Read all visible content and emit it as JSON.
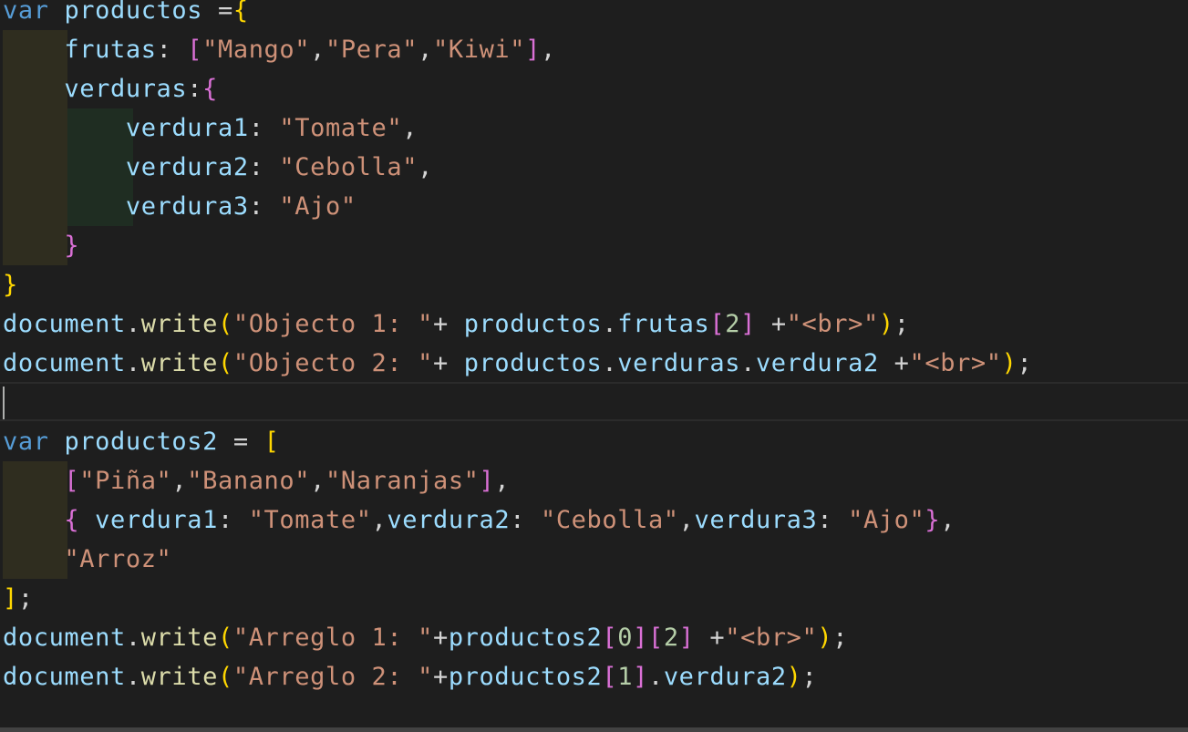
{
  "editor": {
    "language": "javascript",
    "lines": [
      {
        "indent": 0,
        "tokens": [
          {
            "t": "var",
            "c": "kw"
          },
          {
            "t": " "
          },
          {
            "t": "productos",
            "c": "var"
          },
          {
            "t": " =",
            "c": "op"
          },
          {
            "t": "{",
            "c": "b1"
          }
        ]
      },
      {
        "indent": 1,
        "tokens": [
          {
            "t": "    "
          },
          {
            "t": "frutas",
            "c": "var"
          },
          {
            "t": ": ",
            "c": "op"
          },
          {
            "t": "[",
            "c": "b2"
          },
          {
            "t": "\"Mango\"",
            "c": "str"
          },
          {
            "t": ",",
            "c": "op"
          },
          {
            "t": "\"Pera\"",
            "c": "str"
          },
          {
            "t": ",",
            "c": "op"
          },
          {
            "t": "\"Kiwi\"",
            "c": "str"
          },
          {
            "t": "]",
            "c": "b2"
          },
          {
            "t": ",",
            "c": "op"
          }
        ]
      },
      {
        "indent": 1,
        "tokens": [
          {
            "t": "    "
          },
          {
            "t": "verduras",
            "c": "var"
          },
          {
            "t": ":",
            "c": "op"
          },
          {
            "t": "{",
            "c": "b2"
          }
        ]
      },
      {
        "indent": 2,
        "tokens": [
          {
            "t": "        "
          },
          {
            "t": "verdura1",
            "c": "var"
          },
          {
            "t": ": ",
            "c": "op"
          },
          {
            "t": "\"Tomate\"",
            "c": "str"
          },
          {
            "t": ",",
            "c": "op"
          }
        ]
      },
      {
        "indent": 2,
        "tokens": [
          {
            "t": "        "
          },
          {
            "t": "verdura2",
            "c": "var"
          },
          {
            "t": ": ",
            "c": "op"
          },
          {
            "t": "\"Cebolla\"",
            "c": "str"
          },
          {
            "t": ",",
            "c": "op"
          }
        ]
      },
      {
        "indent": 2,
        "tokens": [
          {
            "t": "        "
          },
          {
            "t": "verdura3",
            "c": "var"
          },
          {
            "t": ": ",
            "c": "op"
          },
          {
            "t": "\"Ajo\"",
            "c": "str"
          }
        ]
      },
      {
        "indent": 1,
        "tokens": [
          {
            "t": "    "
          },
          {
            "t": "}",
            "c": "b2"
          }
        ]
      },
      {
        "indent": 0,
        "tokens": [
          {
            "t": "}",
            "c": "b1"
          }
        ]
      },
      {
        "indent": 0,
        "tokens": [
          {
            "t": "document",
            "c": "var"
          },
          {
            "t": ".",
            "c": "op"
          },
          {
            "t": "write",
            "c": "fn"
          },
          {
            "t": "(",
            "c": "b1"
          },
          {
            "t": "\"Objecto 1: \"",
            "c": "str"
          },
          {
            "t": "+ ",
            "c": "op"
          },
          {
            "t": "productos",
            "c": "var"
          },
          {
            "t": ".",
            "c": "op"
          },
          {
            "t": "frutas",
            "c": "var"
          },
          {
            "t": "[",
            "c": "b2"
          },
          {
            "t": "2",
            "c": "num"
          },
          {
            "t": "]",
            "c": "b2"
          },
          {
            "t": " +",
            "c": "op"
          },
          {
            "t": "\"<br>\"",
            "c": "str"
          },
          {
            "t": ")",
            "c": "b1"
          },
          {
            "t": ";",
            "c": "op"
          }
        ]
      },
      {
        "indent": 0,
        "tokens": [
          {
            "t": "document",
            "c": "var"
          },
          {
            "t": ".",
            "c": "op"
          },
          {
            "t": "write",
            "c": "fn"
          },
          {
            "t": "(",
            "c": "b1"
          },
          {
            "t": "\"Objecto 2: \"",
            "c": "str"
          },
          {
            "t": "+ ",
            "c": "op"
          },
          {
            "t": "productos",
            "c": "var"
          },
          {
            "t": ".",
            "c": "op"
          },
          {
            "t": "verduras",
            "c": "var"
          },
          {
            "t": ".",
            "c": "op"
          },
          {
            "t": "verdura2",
            "c": "var"
          },
          {
            "t": " +",
            "c": "op"
          },
          {
            "t": "\"<br>\"",
            "c": "str"
          },
          {
            "t": ")",
            "c": "b1"
          },
          {
            "t": ";",
            "c": "op"
          }
        ]
      },
      {
        "indent": 0,
        "tokens": []
      },
      {
        "indent": 0,
        "tokens": [
          {
            "t": "var",
            "c": "kw"
          },
          {
            "t": " "
          },
          {
            "t": "productos2",
            "c": "var"
          },
          {
            "t": " = ",
            "c": "op"
          },
          {
            "t": "[",
            "c": "b1"
          }
        ]
      },
      {
        "indent": 1,
        "tokens": [
          {
            "t": "    "
          },
          {
            "t": "[",
            "c": "b2"
          },
          {
            "t": "\"Piña\"",
            "c": "str"
          },
          {
            "t": ",",
            "c": "op"
          },
          {
            "t": "\"Banano\"",
            "c": "str"
          },
          {
            "t": ",",
            "c": "op"
          },
          {
            "t": "\"Naranjas\"",
            "c": "str"
          },
          {
            "t": "]",
            "c": "b2"
          },
          {
            "t": ",",
            "c": "op"
          }
        ]
      },
      {
        "indent": 1,
        "tokens": [
          {
            "t": "    "
          },
          {
            "t": "{",
            "c": "b2"
          },
          {
            "t": " "
          },
          {
            "t": "verdura1",
            "c": "var"
          },
          {
            "t": ": ",
            "c": "op"
          },
          {
            "t": "\"Tomate\"",
            "c": "str"
          },
          {
            "t": ",",
            "c": "op"
          },
          {
            "t": "verdura2",
            "c": "var"
          },
          {
            "t": ": ",
            "c": "op"
          },
          {
            "t": "\"Cebolla\"",
            "c": "str"
          },
          {
            "t": ",",
            "c": "op"
          },
          {
            "t": "verdura3",
            "c": "var"
          },
          {
            "t": ": ",
            "c": "op"
          },
          {
            "t": "\"Ajo\"",
            "c": "str"
          },
          {
            "t": "}",
            "c": "b2"
          },
          {
            "t": ",",
            "c": "op"
          }
        ]
      },
      {
        "indent": 1,
        "tokens": [
          {
            "t": "    "
          },
          {
            "t": "\"Arroz\"",
            "c": "str"
          }
        ]
      },
      {
        "indent": 0,
        "tokens": [
          {
            "t": "]",
            "c": "b1"
          },
          {
            "t": ";",
            "c": "op"
          }
        ]
      },
      {
        "indent": 0,
        "tokens": [
          {
            "t": "document",
            "c": "var"
          },
          {
            "t": ".",
            "c": "op"
          },
          {
            "t": "write",
            "c": "fn"
          },
          {
            "t": "(",
            "c": "b1"
          },
          {
            "t": "\"Arreglo 1: \"",
            "c": "str"
          },
          {
            "t": "+",
            "c": "op"
          },
          {
            "t": "productos2",
            "c": "var"
          },
          {
            "t": "[",
            "c": "b2"
          },
          {
            "t": "0",
            "c": "num"
          },
          {
            "t": "]",
            "c": "b2"
          },
          {
            "t": "[",
            "c": "b2"
          },
          {
            "t": "2",
            "c": "num"
          },
          {
            "t": "]",
            "c": "b2"
          },
          {
            "t": " +",
            "c": "op"
          },
          {
            "t": "\"<br>\"",
            "c": "str"
          },
          {
            "t": ")",
            "c": "b1"
          },
          {
            "t": ";",
            "c": "op"
          }
        ]
      },
      {
        "indent": 0,
        "tokens": [
          {
            "t": "document",
            "c": "var"
          },
          {
            "t": ".",
            "c": "op"
          },
          {
            "t": "write",
            "c": "fn"
          },
          {
            "t": "(",
            "c": "b1"
          },
          {
            "t": "\"Arreglo 2: \"",
            "c": "str"
          },
          {
            "t": "+",
            "c": "op"
          },
          {
            "t": "productos2",
            "c": "var"
          },
          {
            "t": "[",
            "c": "b2"
          },
          {
            "t": "1",
            "c": "num"
          },
          {
            "t": "]",
            "c": "b2"
          },
          {
            "t": ".",
            "c": "op"
          },
          {
            "t": "verdura2",
            "c": "var"
          },
          {
            "t": ")",
            "c": "b1"
          },
          {
            "t": ";",
            "c": "op"
          }
        ]
      }
    ],
    "colors": {
      "background": "#1e1e1e",
      "keyword": "#569cd6",
      "variable": "#9cdcfe",
      "function": "#dcdcaa",
      "string": "#ce9178",
      "number": "#b5cea8",
      "bracket_level1": "#ffd700",
      "bracket_level2": "#da70d6"
    }
  }
}
